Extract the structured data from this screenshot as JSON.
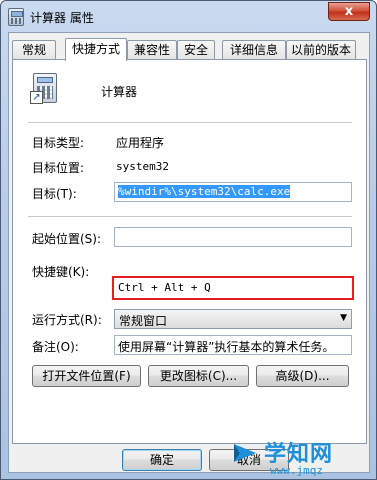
{
  "window": {
    "title": "计算器 属性",
    "close_glyph": "x"
  },
  "tabs": [
    {
      "label": "常规"
    },
    {
      "label": "快捷方式"
    },
    {
      "label": "兼容性"
    },
    {
      "label": "安全"
    },
    {
      "label": "详细信息"
    },
    {
      "label": "以前的版本"
    }
  ],
  "shortcut": {
    "app_name": "计算器",
    "target_type_label": "目标类型:",
    "target_type_value": "应用程序",
    "target_location_label": "目标位置:",
    "target_location_value": "system32",
    "target_label": "目标(T):",
    "target_value": "%windir%\\system32\\calc.exe",
    "start_in_label": "起始位置(S):",
    "start_in_value": "",
    "hotkey_label": "快捷键(K):",
    "hotkey_value": "Ctrl + Alt + Q",
    "run_label": "运行方式(R):",
    "run_value": "常规窗口",
    "comment_label": "备注(O):",
    "comment_value": "使用屏幕“计算器”执行基本的算术任务。",
    "open_location_button": "打开文件位置(F)",
    "change_icon_button": "更改图标(C)...",
    "advanced_button": "高级(D)..."
  },
  "footer": {
    "ok_button": "确定",
    "cancel_button": "取消"
  },
  "watermark": {
    "brand": "学知网",
    "url": "www.jmqz"
  },
  "colors": {
    "hotkey_highlight": "#e51e1e",
    "selection": "#3399ff"
  }
}
